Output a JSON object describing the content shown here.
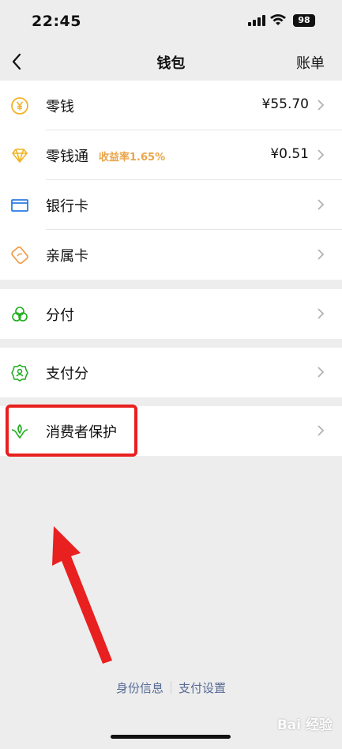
{
  "status_bar": {
    "time": "22:45",
    "battery": "98"
  },
  "nav": {
    "title": "钱包",
    "right_label": "账单"
  },
  "groups": {
    "main": [
      {
        "label": "零钱",
        "value": "¥55.70"
      },
      {
        "label": "零钱通",
        "sub": "收益率1.65%",
        "value": "¥0.51"
      },
      {
        "label": "银行卡"
      },
      {
        "label": "亲属卡"
      }
    ],
    "fenfu": {
      "label": "分付"
    },
    "score": {
      "label": "支付分"
    },
    "protect": {
      "label": "消费者保护"
    }
  },
  "footer": {
    "identity": "身份信息",
    "settings": "支付设置"
  },
  "watermark": "Bai 经验",
  "colors": {
    "accent_gold": "#e9a54b",
    "link_blue": "#576b95",
    "highlight_red": "#e8201f",
    "icon_green": "#1aad19",
    "icon_blue": "#2c7be5"
  }
}
